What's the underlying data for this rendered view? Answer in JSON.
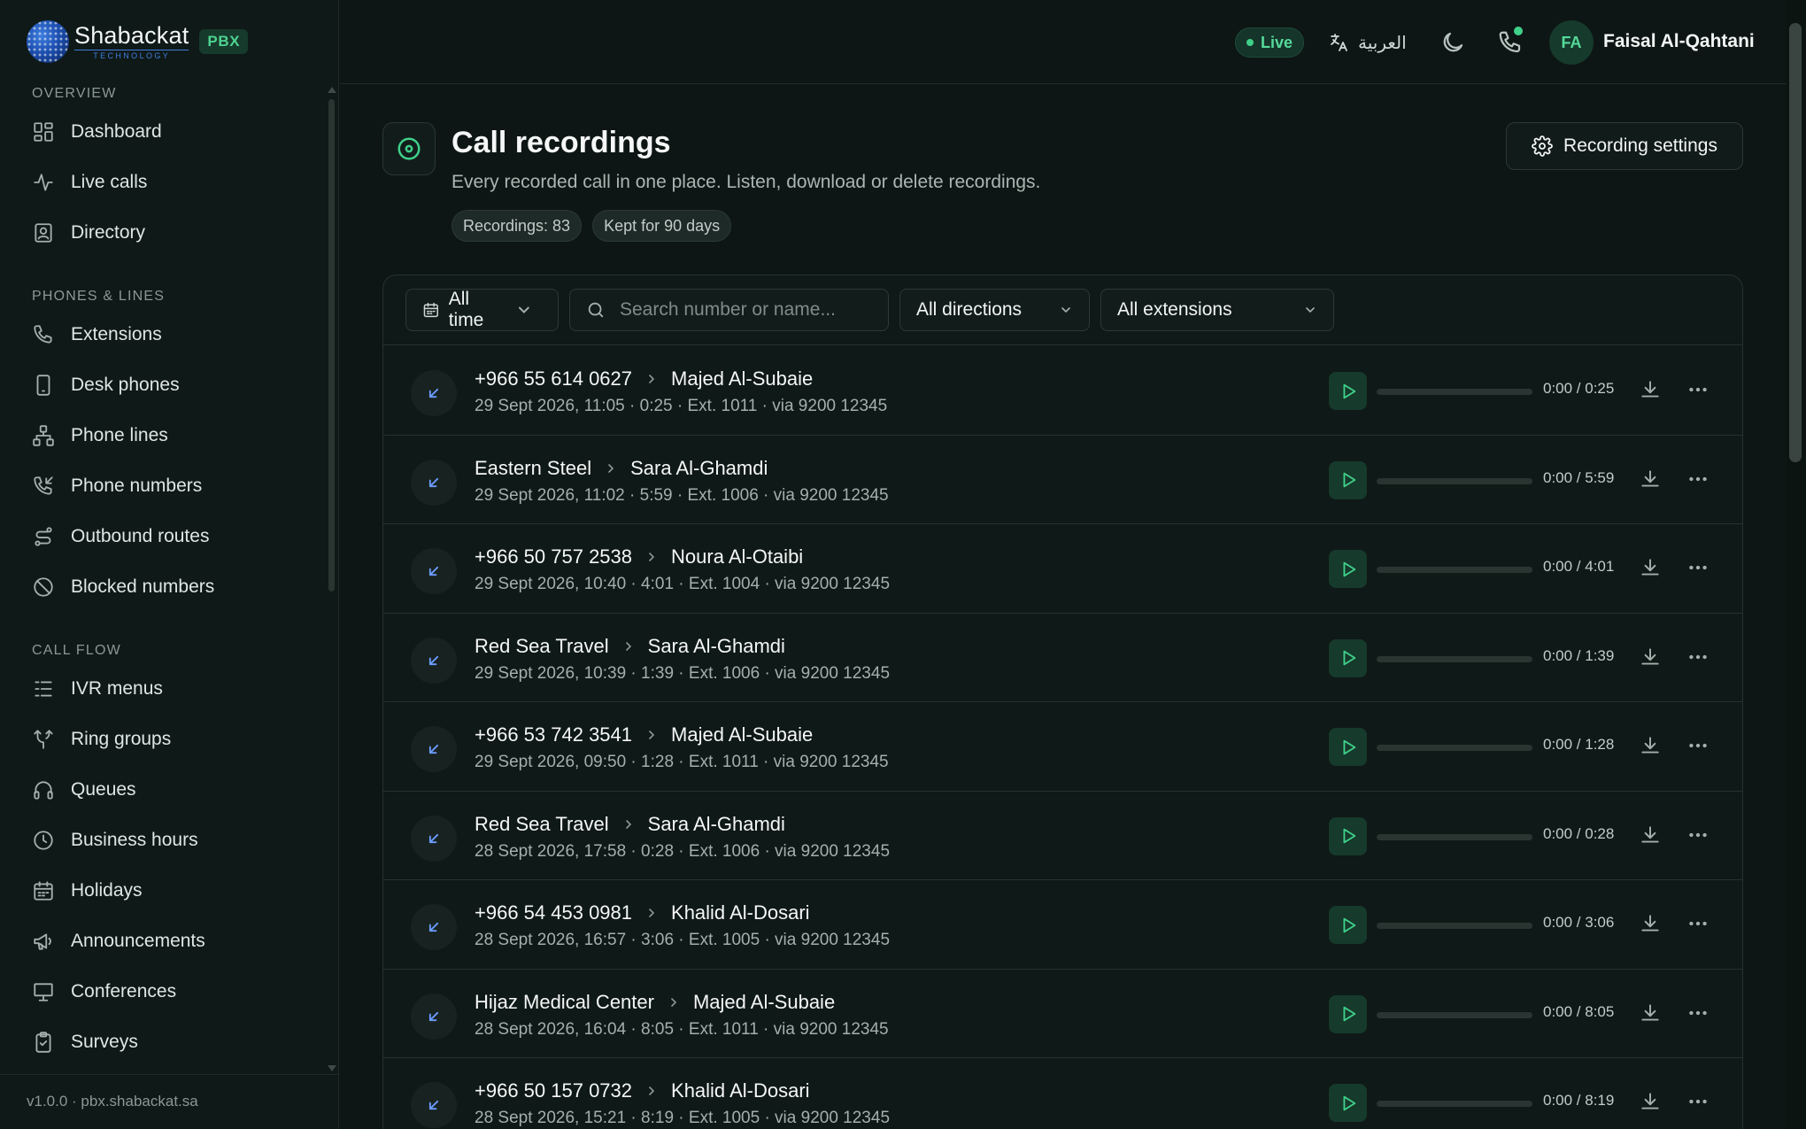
{
  "brand": {
    "name": "Shabackat",
    "sub": "TECHNOLOGY",
    "badge": "PBX"
  },
  "sidebar": {
    "sections": [
      {
        "title": "OVERVIEW",
        "items": [
          {
            "label": "Dashboard",
            "icon": "dashboard-icon"
          },
          {
            "label": "Live calls",
            "icon": "activity-icon"
          },
          {
            "label": "Directory",
            "icon": "contact-book-icon"
          }
        ]
      },
      {
        "title": "PHONES & LINES",
        "items": [
          {
            "label": "Extensions",
            "icon": "phone-icon"
          },
          {
            "label": "Desk phones",
            "icon": "device-icon"
          },
          {
            "label": "Phone lines",
            "icon": "network-icon"
          },
          {
            "label": "Phone numbers",
            "icon": "phone-incoming-icon"
          },
          {
            "label": "Outbound routes",
            "icon": "route-icon"
          },
          {
            "label": "Blocked numbers",
            "icon": "block-icon"
          }
        ]
      },
      {
        "title": "CALL FLOW",
        "items": [
          {
            "label": "IVR menus",
            "icon": "list-icon"
          },
          {
            "label": "Ring groups",
            "icon": "split-icon"
          },
          {
            "label": "Queues",
            "icon": "headphones-icon"
          },
          {
            "label": "Business hours",
            "icon": "clock-icon"
          },
          {
            "label": "Holidays",
            "icon": "calendar-icon"
          },
          {
            "label": "Announcements",
            "icon": "megaphone-icon"
          },
          {
            "label": "Conferences",
            "icon": "presentation-icon"
          },
          {
            "label": "Surveys",
            "icon": "clipboard-icon"
          }
        ]
      }
    ],
    "version": "v1.0.0 · pbx.shabackat.sa"
  },
  "topbar": {
    "live": "Live",
    "language": "العربية",
    "avatar": "FA",
    "user": "Faisal Al-Qahtani"
  },
  "page": {
    "title": "Call recordings",
    "subtitle": "Every recorded call in one place. Listen, download or delete recordings.",
    "chips": [
      "Recordings: 83",
      "Kept for 90 days"
    ],
    "settings_button": "Recording settings"
  },
  "filters": {
    "time": "All time",
    "search_placeholder": "Search number or name...",
    "direction": "All directions",
    "extension": "All extensions"
  },
  "recordings": [
    {
      "from": "+966 55 614 0627",
      "to": "Majed Al-Subaie",
      "meta": "29 Sept 2026, 11:05 · 0:25 · Ext. 1011 · via 9200 12345",
      "time": "0:00 / 0:25"
    },
    {
      "from": "Eastern Steel",
      "to": "Sara Al-Ghamdi",
      "meta": "29 Sept 2026, 11:02 · 5:59 · Ext. 1006 · via 9200 12345",
      "time": "0:00 / 5:59"
    },
    {
      "from": "+966 50 757 2538",
      "to": "Noura Al-Otaibi",
      "meta": "29 Sept 2026, 10:40 · 4:01 · Ext. 1004 · via 9200 12345",
      "time": "0:00 / 4:01"
    },
    {
      "from": "Red Sea Travel",
      "to": "Sara Al-Ghamdi",
      "meta": "29 Sept 2026, 10:39 · 1:39 · Ext. 1006 · via 9200 12345",
      "time": "0:00 / 1:39"
    },
    {
      "from": "+966 53 742 3541",
      "to": "Majed Al-Subaie",
      "meta": "29 Sept 2026, 09:50 · 1:28 · Ext. 1011 · via 9200 12345",
      "time": "0:00 / 1:28"
    },
    {
      "from": "Red Sea Travel",
      "to": "Sara Al-Ghamdi",
      "meta": "28 Sept 2026, 17:58 · 0:28 · Ext. 1006 · via 9200 12345",
      "time": "0:00 / 0:28"
    },
    {
      "from": "+966 54 453 0981",
      "to": "Khalid Al-Dosari",
      "meta": "28 Sept 2026, 16:57 · 3:06 · Ext. 1005 · via 9200 12345",
      "time": "0:00 / 3:06"
    },
    {
      "from": "Hijaz Medical Center",
      "to": "Majed Al-Subaie",
      "meta": "28 Sept 2026, 16:04 · 8:05 · Ext. 1011 · via 9200 12345",
      "time": "0:00 / 8:05"
    },
    {
      "from": "+966 50 157 0732",
      "to": "Khalid Al-Dosari",
      "meta": "28 Sept 2026, 15:21 · 8:19 · Ext. 1005 · via 9200 12345",
      "time": "0:00 / 8:19"
    }
  ]
}
